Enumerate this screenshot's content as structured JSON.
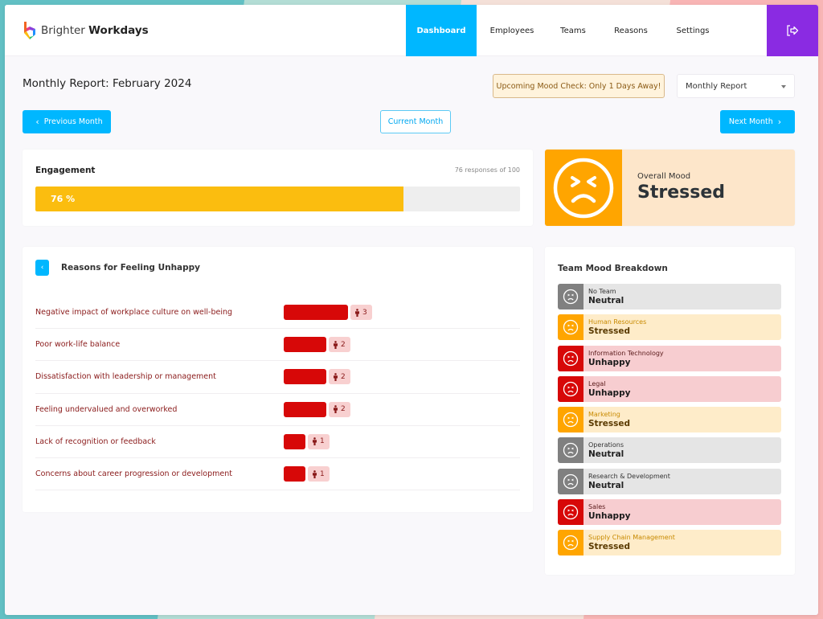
{
  "app": {
    "brand_light": "Brighter",
    "brand_bold": "Workdays"
  },
  "nav": {
    "items": [
      {
        "label": "Dashboard",
        "active": true
      },
      {
        "label": "Employees",
        "active": false
      },
      {
        "label": "Teams",
        "active": false
      },
      {
        "label": "Reasons",
        "active": false
      },
      {
        "label": "Settings",
        "active": false
      }
    ],
    "logout_icon": "logout-icon"
  },
  "report": {
    "title_prefix": "Monthly Report:",
    "period": "February 2024",
    "alert": "Upcoming Mood Check: Only 1 Days Away!",
    "report_type_selected": "Monthly Report"
  },
  "buttons": {
    "previous": "Previous Month",
    "current": "Current Month",
    "next": "Next Month"
  },
  "engagement": {
    "title": "Engagement",
    "responses_text": "76 responses of 100",
    "percent": 76,
    "percent_label": "76 %"
  },
  "overall_mood": {
    "label": "Overall Mood",
    "value": "Stressed",
    "icon": "stressed-face-icon",
    "color": "#ffa500"
  },
  "reasons": {
    "title": "Reasons for Feeling Unhappy",
    "max_count": 3,
    "items": [
      {
        "label": "Negative impact of workplace culture on well-being",
        "count": 3
      },
      {
        "label": "Poor work-life balance",
        "count": 2
      },
      {
        "label": "Dissatisfaction with leadership or management",
        "count": 2
      },
      {
        "label": "Feeling undervalued and overworked",
        "count": 2
      },
      {
        "label": "Lack of recognition or feedback",
        "count": 1
      },
      {
        "label": "Concerns about career progression or development",
        "count": 1
      }
    ]
  },
  "teams": {
    "title": "Team Mood Breakdown",
    "items": [
      {
        "name": "No Team",
        "mood": "Neutral"
      },
      {
        "name": "Human Resources",
        "mood": "Stressed"
      },
      {
        "name": "Information Technology",
        "mood": "Unhappy"
      },
      {
        "name": "Legal",
        "mood": "Unhappy"
      },
      {
        "name": "Marketing",
        "mood": "Stressed"
      },
      {
        "name": "Operations",
        "mood": "Neutral"
      },
      {
        "name": "Research & Development",
        "mood": "Neutral"
      },
      {
        "name": "Sales",
        "mood": "Unhappy"
      },
      {
        "name": "Supply Chain Management",
        "mood": "Stressed"
      }
    ]
  },
  "colors": {
    "primary": "#00b7ff",
    "logout": "#8a2be2",
    "engagement": "#fbbd0f",
    "stressed": "#ffa500",
    "unhappy": "#d70808",
    "neutral": "#808080"
  }
}
